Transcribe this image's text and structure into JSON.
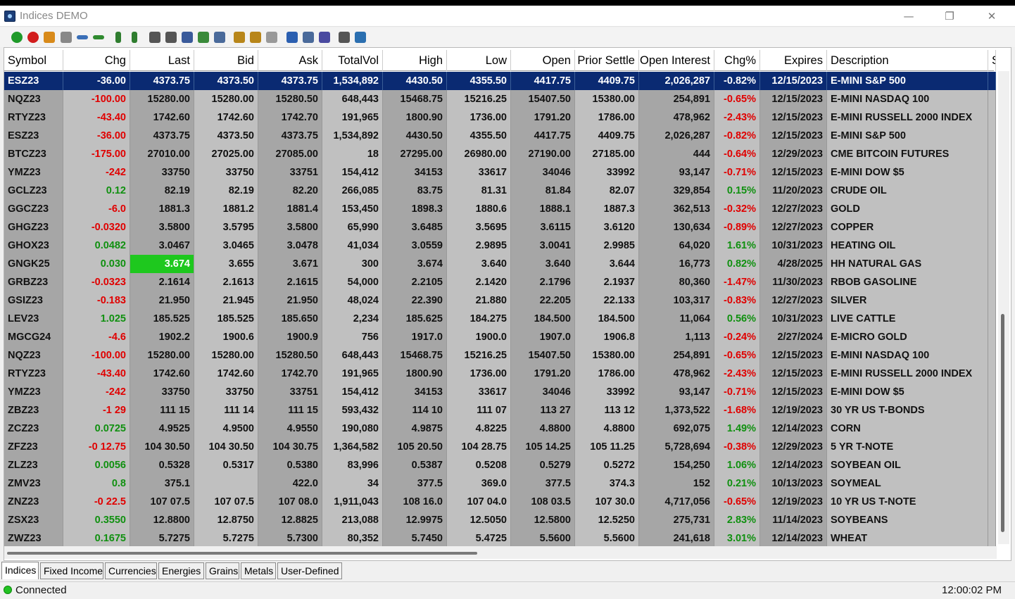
{
  "window": {
    "title": "Indices DEMO",
    "minimize": "—",
    "maximize": "❐",
    "close": "✕"
  },
  "toolbar": {
    "icons": [
      "add-icon",
      "remove-icon",
      "open-icon",
      "new-icon",
      "undo-icon",
      "redo-icon",
      "move-up-icon",
      "move-down-icon",
      "tools-icon",
      "settings-icon",
      "font-icon",
      "export-icon",
      "import-icon",
      "people-icon",
      "people-edit-icon",
      "people-remove-icon",
      "book-icon",
      "image-icon",
      "link-icon",
      "cut-icon",
      "add-column-dropdown-icon"
    ]
  },
  "columns": [
    {
      "label": "Symbol",
      "align": "l"
    },
    {
      "label": "Chg",
      "align": "r"
    },
    {
      "label": "Last",
      "align": "r"
    },
    {
      "label": "Bid",
      "align": "r"
    },
    {
      "label": "Ask",
      "align": "r"
    },
    {
      "label": "TotalVol",
      "align": "r"
    },
    {
      "label": "High",
      "align": "r"
    },
    {
      "label": "Low",
      "align": "r"
    },
    {
      "label": "Open",
      "align": "r"
    },
    {
      "label": "Prior Settle",
      "align": "r"
    },
    {
      "label": "Open Interest",
      "align": "r"
    },
    {
      "label": "Chg%",
      "align": "r"
    },
    {
      "label": "Expires",
      "align": "r"
    },
    {
      "label": "Description",
      "align": "l"
    },
    {
      "label": "S",
      "align": "l"
    }
  ],
  "rows": [
    [
      "ESZ23",
      "-36.00",
      "4373.75",
      "4373.50",
      "4373.75",
      "1,534,892",
      "4430.50",
      "4355.50",
      "4417.75",
      "4409.75",
      "2,026,287",
      "-0.82%",
      "12/15/2023",
      "E-MINI S&P 500"
    ],
    [
      "NQZ23",
      "-100.00",
      "15280.00",
      "15280.00",
      "15280.50",
      "648,443",
      "15468.75",
      "15216.25",
      "15407.50",
      "15380.00",
      "254,891",
      "-0.65%",
      "12/15/2023",
      "E-MINI NASDAQ 100"
    ],
    [
      "RTYZ23",
      "-43.40",
      "1742.60",
      "1742.60",
      "1742.70",
      "191,965",
      "1800.90",
      "1736.00",
      "1791.20",
      "1786.00",
      "478,962",
      "-2.43%",
      "12/15/2023",
      "E-MINI RUSSELL 2000 INDEX"
    ],
    [
      "ESZ23",
      "-36.00",
      "4373.75",
      "4373.50",
      "4373.75",
      "1,534,892",
      "4430.50",
      "4355.50",
      "4417.75",
      "4409.75",
      "2,026,287",
      "-0.82%",
      "12/15/2023",
      "E-MINI S&P 500"
    ],
    [
      "BTCZ23",
      "-175.00",
      "27010.00",
      "27025.00",
      "27085.00",
      "18",
      "27295.00",
      "26980.00",
      "27190.00",
      "27185.00",
      "444",
      "-0.64%",
      "12/29/2023",
      "CME BITCOIN FUTURES"
    ],
    [
      "YMZ23",
      "-242",
      "33750",
      "33750",
      "33751",
      "154,412",
      "34153",
      "33617",
      "34046",
      "33992",
      "93,147",
      "-0.71%",
      "12/15/2023",
      "E-MINI DOW $5"
    ],
    [
      "GCLZ23",
      "0.12",
      "82.19",
      "82.19",
      "82.20",
      "266,085",
      "83.75",
      "81.31",
      "81.84",
      "82.07",
      "329,854",
      "0.15%",
      "11/20/2023",
      "CRUDE OIL"
    ],
    [
      "GGCZ23",
      "-6.0",
      "1881.3",
      "1881.2",
      "1881.4",
      "153,450",
      "1898.3",
      "1880.6",
      "1888.1",
      "1887.3",
      "362,513",
      "-0.32%",
      "12/27/2023",
      "GOLD"
    ],
    [
      "GHGZ23",
      "-0.0320",
      "3.5800",
      "3.5795",
      "3.5800",
      "65,990",
      "3.6485",
      "3.5695",
      "3.6115",
      "3.6120",
      "130,634",
      "-0.89%",
      "12/27/2023",
      "COPPER"
    ],
    [
      "GHOX23",
      "0.0482",
      "3.0467",
      "3.0465",
      "3.0478",
      "41,034",
      "3.0559",
      "2.9895",
      "3.0041",
      "2.9985",
      "64,020",
      "1.61%",
      "10/31/2023",
      "HEATING OIL"
    ],
    [
      "GNGK25",
      "0.030",
      "3.674",
      "3.655",
      "3.671",
      "300",
      "3.674",
      "3.640",
      "3.640",
      "3.644",
      "16,773",
      "0.82%",
      "4/28/2025",
      "HH NATURAL GAS"
    ],
    [
      "GRBZ23",
      "-0.0323",
      "2.1614",
      "2.1613",
      "2.1615",
      "54,000",
      "2.2105",
      "2.1420",
      "2.1796",
      "2.1937",
      "80,360",
      "-1.47%",
      "11/30/2023",
      "RBOB GASOLINE"
    ],
    [
      "GSIZ23",
      "-0.183",
      "21.950",
      "21.945",
      "21.950",
      "48,024",
      "22.390",
      "21.880",
      "22.205",
      "22.133",
      "103,317",
      "-0.83%",
      "12/27/2023",
      "SILVER"
    ],
    [
      "LEV23",
      "1.025",
      "185.525",
      "185.525",
      "185.650",
      "2,234",
      "185.625",
      "184.275",
      "184.500",
      "184.500",
      "11,064",
      "0.56%",
      "10/31/2023",
      "LIVE CATTLE"
    ],
    [
      "MGCG24",
      "-4.6",
      "1902.2",
      "1900.6",
      "1900.9",
      "756",
      "1917.0",
      "1900.0",
      "1907.0",
      "1906.8",
      "1,113",
      "-0.24%",
      "2/27/2024",
      "E-MICRO GOLD"
    ],
    [
      "NQZ23",
      "-100.00",
      "15280.00",
      "15280.00",
      "15280.50",
      "648,443",
      "15468.75",
      "15216.25",
      "15407.50",
      "15380.00",
      "254,891",
      "-0.65%",
      "12/15/2023",
      "E-MINI NASDAQ 100"
    ],
    [
      "RTYZ23",
      "-43.40",
      "1742.60",
      "1742.60",
      "1742.70",
      "191,965",
      "1800.90",
      "1736.00",
      "1791.20",
      "1786.00",
      "478,962",
      "-2.43%",
      "12/15/2023",
      "E-MINI RUSSELL 2000 INDEX"
    ],
    [
      "YMZ23",
      "-242",
      "33750",
      "33750",
      "33751",
      "154,412",
      "34153",
      "33617",
      "34046",
      "33992",
      "93,147",
      "-0.71%",
      "12/15/2023",
      "E-MINI DOW $5"
    ],
    [
      "ZBZ23",
      "-1 29",
      "111 15",
      "111 14",
      "111 15",
      "593,432",
      "114 10",
      "111 07",
      "113 27",
      "113 12",
      "1,373,522",
      "-1.68%",
      "12/19/2023",
      "30 YR US T-BONDS"
    ],
    [
      "ZCZ23",
      "0.0725",
      "4.9525",
      "4.9500",
      "4.9550",
      "190,080",
      "4.9875",
      "4.8225",
      "4.8800",
      "4.8800",
      "692,075",
      "1.49%",
      "12/14/2023",
      "CORN"
    ],
    [
      "ZFZ23",
      "-0 12.75",
      "104 30.50",
      "104 30.50",
      "104 30.75",
      "1,364,582",
      "105 20.50",
      "104 28.75",
      "105 14.25",
      "105 11.25",
      "5,728,694",
      "-0.38%",
      "12/29/2023",
      "5 YR T-NOTE"
    ],
    [
      "ZLZ23",
      "0.0056",
      "0.5328",
      "0.5317",
      "0.5380",
      "83,996",
      "0.5387",
      "0.5208",
      "0.5279",
      "0.5272",
      "154,250",
      "1.06%",
      "12/14/2023",
      "SOYBEAN OIL"
    ],
    [
      "ZMV23",
      "0.8",
      "375.1",
      "",
      "422.0",
      "34",
      "377.5",
      "369.0",
      "377.5",
      "374.3",
      "152",
      "0.21%",
      "10/13/2023",
      "SOYMEAL"
    ],
    [
      "ZNZ23",
      "-0 22.5",
      "107 07.5",
      "107 07.5",
      "107 08.0",
      "1,911,043",
      "108 16.0",
      "107 04.0",
      "108 03.5",
      "107 30.0",
      "4,717,056",
      "-0.65%",
      "12/19/2023",
      "10 YR US T-NOTE"
    ],
    [
      "ZSX23",
      "0.3550",
      "12.8800",
      "12.8750",
      "12.8825",
      "213,088",
      "12.9975",
      "12.5050",
      "12.5800",
      "12.5250",
      "275,731",
      "2.83%",
      "11/14/2023",
      "SOYBEANS"
    ],
    [
      "ZWZ23",
      "0.1675",
      "5.7275",
      "5.7275",
      "5.7300",
      "80,352",
      "5.7450",
      "5.4725",
      "5.5600",
      "5.5600",
      "241,618",
      "3.01%",
      "12/14/2023",
      "WHEAT"
    ]
  ],
  "selected_row": 0,
  "flash_cell": {
    "row": 10,
    "col": 2,
    "color": "#1ec81e"
  },
  "colors": {
    "selected_bg": "#0a2a72",
    "row_dark": "#a6a6a6",
    "row_light": "#c0c0c0",
    "negative": "#e00000",
    "positive": "#109010"
  },
  "tabs": [
    "Indices",
    "Fixed Income",
    "Currencies",
    "Energies",
    "Grains",
    "Metals",
    "User-Defined"
  ],
  "active_tab": 0,
  "status": {
    "connection": "Connected",
    "time": "12:00:02 PM"
  }
}
